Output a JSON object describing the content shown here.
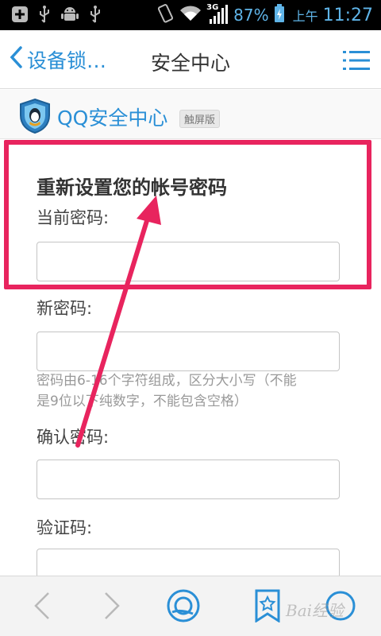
{
  "status_bar": {
    "network": "3G",
    "battery": "87%",
    "ampm": "上午",
    "time": "11:27"
  },
  "nav": {
    "back_label": "设备锁…",
    "title": "安全中心"
  },
  "brand": {
    "name": "QQ安全中心",
    "badge": "触屏版"
  },
  "form": {
    "heading": "重新设置您的帐号密码",
    "current_password_label": "当前密码:",
    "current_password_value": "",
    "new_password_label": "新密码:",
    "new_password_value": "",
    "hint_line1": "密码由6-16个字符组成，区分大小写（不能",
    "hint_line2": "是9位以下纯数字，不能包含空格）",
    "confirm_password_label": "确认密码:",
    "confirm_password_value": "",
    "captcha_label": "验证码:",
    "captcha_value": ""
  },
  "watermark": "Bai经验",
  "colors": {
    "accent": "#2a8fd6",
    "highlight": "#e8245e",
    "status_text": "#5fb4e8"
  }
}
